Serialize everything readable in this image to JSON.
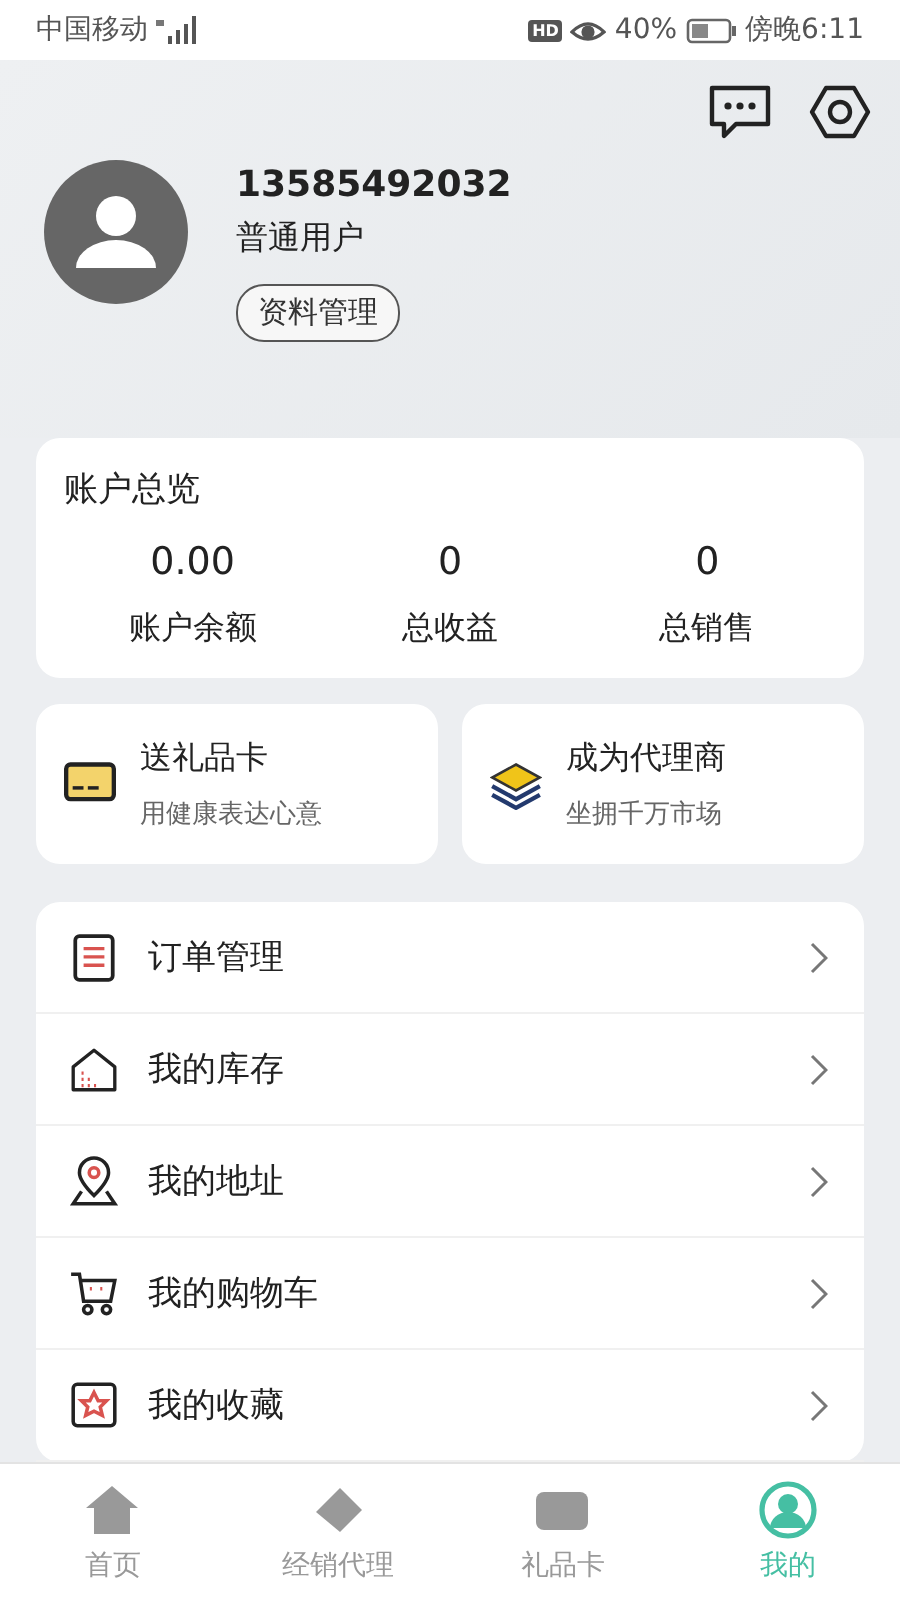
{
  "status_bar": {
    "carrier": "中国移动",
    "hd_badge": "HD",
    "battery": "40%",
    "time": "傍晚6:11"
  },
  "profile": {
    "phone": "13585492032",
    "role": "普通用户",
    "edit_button": "资料管理"
  },
  "overview": {
    "title": "账户总览",
    "stats": [
      {
        "value": "0.00",
        "label": "账户余额"
      },
      {
        "value": "0",
        "label": "总收益"
      },
      {
        "value": "0",
        "label": "总销售"
      }
    ]
  },
  "promos": [
    {
      "kind": "card",
      "title": "送礼品卡",
      "subtitle": "用健康表达心意"
    },
    {
      "kind": "layers",
      "title": "成为代理商",
      "subtitle": "坐拥千万市场"
    }
  ],
  "menu": [
    {
      "kind": "orders",
      "label": "订单管理"
    },
    {
      "kind": "stock",
      "label": "我的库存"
    },
    {
      "kind": "address",
      "label": "我的地址"
    },
    {
      "kind": "cart",
      "label": "我的购物车"
    },
    {
      "kind": "favorites",
      "label": "我的收藏"
    }
  ],
  "tabs": [
    {
      "kind": "home",
      "label": "首页",
      "selected": false
    },
    {
      "kind": "agent",
      "label": "经销代理",
      "selected": false
    },
    {
      "kind": "giftcard",
      "label": "礼品卡",
      "selected": false
    },
    {
      "kind": "me",
      "label": "我的",
      "selected": true
    }
  ]
}
